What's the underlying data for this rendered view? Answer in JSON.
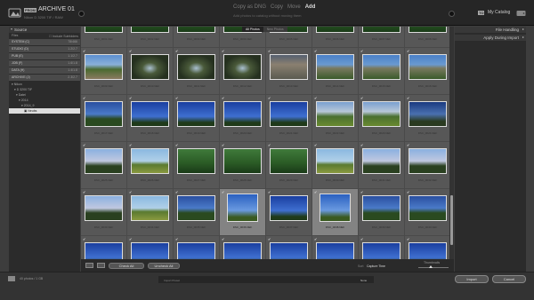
{
  "header": {
    "from_badge": "FROM",
    "source_title": "ARCHIVE 01",
    "source_sub": "Nikon D 3200 TIF / RAW",
    "modes": [
      "Copy as DNG",
      "Copy",
      "Move",
      "Add"
    ],
    "active_mode": "Add",
    "mode_sub": "Add photos to catalog without moving them",
    "to_badge": "TO",
    "catalog_label": "My Catalog"
  },
  "left_panel": {
    "title": "Source",
    "files_label": "Files",
    "include_sub": "Include Subfolders",
    "volumes": [
      {
        "name": "SYSTEM (C)",
        "size": "78/466"
      },
      {
        "name": "STUDIO (D)",
        "size": "1.2/2.7"
      },
      {
        "name": "PUB (E)",
        "size": "1.1/2.7"
      },
      {
        "name": "JOB (F)",
        "size": "1.6/1.8"
      },
      {
        "name": "DATA (H)",
        "size": "1.4/1.8"
      },
      {
        "name": "ARCHIVE (J)",
        "size": "2.3/2.7"
      }
    ],
    "tree": [
      {
        "label": "Nikon",
        "indent": 3
      },
      {
        "label": "D 3200 TIF",
        "indent": 6
      },
      {
        "label": "Datei",
        "indent": 8
      },
      {
        "label": "2014",
        "indent": 11
      },
      {
        "label": "2014_9",
        "indent": 14
      },
      {
        "label": "Neubs",
        "indent": 17
      }
    ]
  },
  "grid": {
    "tabs": [
      "All Photos",
      "New Photos"
    ],
    "active_tab": "All Photos",
    "rows": [
      [
        {
          "name": "DSC_0001.NEF",
          "checked": true,
          "selected": false,
          "scene": "forest"
        },
        {
          "name": "DSC_0002.NEF",
          "checked": true,
          "selected": false,
          "scene": "forest"
        },
        {
          "name": "DSC_0003.NEF",
          "checked": true,
          "selected": false,
          "scene": "forest"
        },
        {
          "name": "DSC_0004.NEF",
          "checked": true,
          "selected": false,
          "scene": "forest"
        },
        {
          "name": "DSC_0005.NEF",
          "checked": true,
          "selected": false,
          "scene": "forest"
        },
        {
          "name": "DSC_0006.NEF",
          "checked": true,
          "selected": false,
          "scene": "forest"
        },
        {
          "name": "DSC_0007.NEF",
          "checked": true,
          "selected": false,
          "scene": "forest"
        },
        {
          "name": "DSC_0008.NEF",
          "checked": true,
          "selected": false,
          "scene": "forest"
        }
      ],
      [
        {
          "name": "DSC_0009.NEF",
          "checked": true,
          "selected": false,
          "scene": "road"
        },
        {
          "name": "DSC_0010.NEF",
          "checked": true,
          "selected": false,
          "scene": "cave"
        },
        {
          "name": "DSC_0011.NEF",
          "checked": true,
          "selected": false,
          "scene": "cave"
        },
        {
          "name": "DSC_0012.NEF",
          "checked": true,
          "selected": false,
          "scene": "cave"
        },
        {
          "name": "DSC_0013.NEF",
          "checked": true,
          "selected": false,
          "scene": "rocks"
        },
        {
          "name": "DSC_0014.NEF",
          "checked": true,
          "selected": false,
          "scene": "cliff"
        },
        {
          "name": "DSC_0015.NEF",
          "checked": true,
          "selected": false,
          "scene": "cliff"
        },
        {
          "name": "DSC_0016.NEF",
          "checked": true,
          "selected": false,
          "scene": "cliff"
        }
      ],
      [
        {
          "name": "DSC_0017.NEF",
          "checked": true,
          "selected": false,
          "scene": "trees"
        },
        {
          "name": "DSC_0018.NEF",
          "checked": true,
          "selected": false,
          "scene": "sky"
        },
        {
          "name": "DSC_0019.NEF",
          "checked": true,
          "selected": false,
          "scene": "sky"
        },
        {
          "name": "DSC_0020.NEF",
          "checked": true,
          "selected": false,
          "scene": "sky"
        },
        {
          "name": "DSC_0021.NEF",
          "checked": true,
          "selected": false,
          "scene": "sky"
        },
        {
          "name": "DSC_0022.NEF",
          "checked": true,
          "selected": false,
          "scene": "meadow"
        },
        {
          "name": "DSC_0023.NEF",
          "checked": true,
          "selected": false,
          "scene": "meadow"
        },
        {
          "name": "DSC_0024.NEF",
          "checked": true,
          "selected": false,
          "scene": "moon"
        }
      ],
      [
        {
          "name": "DSC_0025.NEF",
          "checked": true,
          "selected": false,
          "scene": "dusk"
        },
        {
          "name": "DSC_0026.NEF",
          "checked": true,
          "selected": false,
          "scene": "field"
        },
        {
          "name": "DSC_0027.NEF",
          "checked": true,
          "selected": false,
          "scene": "forest"
        },
        {
          "name": "DSC_0028.NEF",
          "checked": true,
          "selected": false,
          "scene": "forest"
        },
        {
          "name": "DSC_0029.NEF",
          "checked": true,
          "selected": false,
          "scene": "forest"
        },
        {
          "name": "DSC_0030.NEF",
          "checked": true,
          "selected": false,
          "scene": "field"
        },
        {
          "name": "DSC_0031.NEF",
          "checked": true,
          "selected": false,
          "scene": "dusk"
        },
        {
          "name": "DSC_0032.NEF",
          "checked": true,
          "selected": false,
          "scene": "dusk"
        }
      ],
      [
        {
          "name": "DSC_0033.NEF",
          "checked": true,
          "selected": false,
          "scene": "dusk"
        },
        {
          "name": "DSC_0034.NEF",
          "checked": true,
          "selected": false,
          "scene": "field"
        },
        {
          "name": "DSC_0035.NEF",
          "checked": true,
          "selected": false,
          "scene": "trees"
        },
        {
          "name": "DSC_0036.NEF",
          "checked": true,
          "selected": true,
          "scene": "tree"
        },
        {
          "name": "DSC_0037.NEF",
          "checked": true,
          "selected": false,
          "scene": "sky"
        },
        {
          "name": "DSC_0038.NEF",
          "checked": true,
          "selected": true,
          "scene": "tree"
        },
        {
          "name": "DSC_0039.NEF",
          "checked": true,
          "selected": false,
          "scene": "trees"
        },
        {
          "name": "DSC_0040.NEF",
          "checked": true,
          "selected": false,
          "scene": "trees"
        }
      ],
      [
        {
          "name": "",
          "checked": true,
          "selected": false,
          "scene": "sky"
        },
        {
          "name": "",
          "checked": true,
          "selected": false,
          "scene": "sky"
        },
        {
          "name": "",
          "checked": true,
          "selected": false,
          "scene": "sky"
        },
        {
          "name": "",
          "checked": true,
          "selected": false,
          "scene": "sky"
        },
        {
          "name": "",
          "checked": true,
          "selected": false,
          "scene": "sky"
        },
        {
          "name": "",
          "checked": true,
          "selected": false,
          "scene": "sky"
        },
        {
          "name": "",
          "checked": true,
          "selected": false,
          "scene": "sky"
        },
        {
          "name": "",
          "checked": true,
          "selected": false,
          "scene": "sky"
        }
      ]
    ]
  },
  "toolbar": {
    "check_all": "Check All",
    "uncheck_all": "Uncheck All",
    "sort_label": "Sort",
    "sort_value": "Capture Time",
    "thumb_label": "Thumbnails"
  },
  "right_panel": {
    "sections": [
      "File Handling",
      "Apply During Import"
    ]
  },
  "footer": {
    "summary": "40 photos / 1 GB",
    "preset_label": "Import Preset",
    "preset_value": "None",
    "import_label": "Import",
    "cancel_label": "Cancel"
  }
}
